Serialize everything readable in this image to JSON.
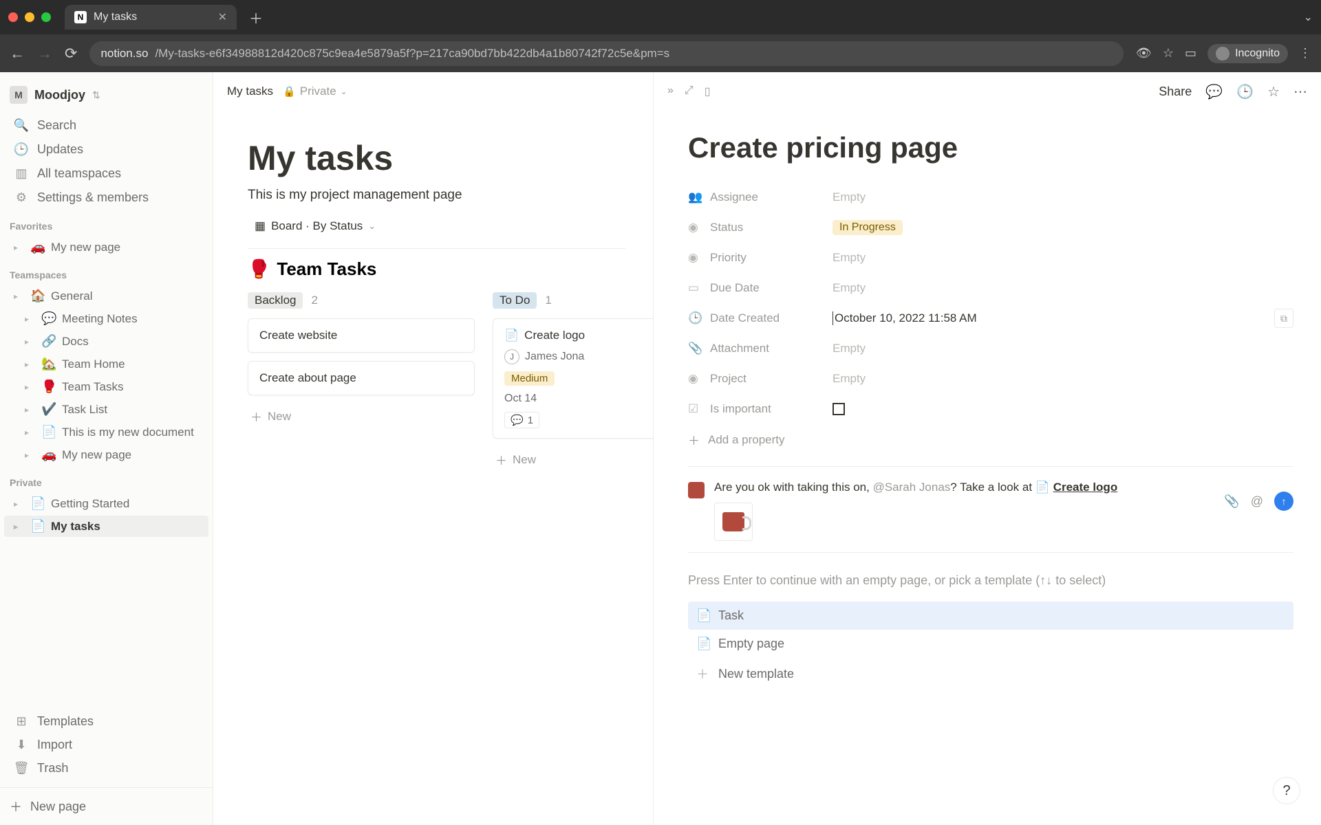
{
  "browser": {
    "tab_title": "My tasks",
    "url_domain": "notion.so",
    "url_path": "/My-tasks-e6f34988812d420c875c9ea4e5879a5f?p=217ca90bd7bb422db4a1b80742f72c5e&pm=s",
    "incognito_label": "Incognito"
  },
  "workspace": {
    "initial": "M",
    "name": "Moodjoy"
  },
  "sidebar": {
    "main": [
      {
        "icon": "🔍",
        "label": "Search"
      },
      {
        "icon": "🕒",
        "label": "Updates"
      },
      {
        "icon": "▥",
        "label": "All teamspaces"
      },
      {
        "icon": "⚙",
        "label": "Settings & members"
      }
    ],
    "sections": {
      "favorites_label": "Favorites",
      "favorites": [
        {
          "emoji": "🚗",
          "label": "My new page"
        }
      ],
      "teamspaces_label": "Teamspaces",
      "teamspaces": [
        {
          "emoji": "🏠",
          "label": "General",
          "indent": 0
        },
        {
          "emoji": "💬",
          "label": "Meeting Notes",
          "indent": 1
        },
        {
          "emoji": "🔗",
          "label": "Docs",
          "indent": 1
        },
        {
          "emoji": "🏡",
          "label": "Team Home",
          "indent": 1
        },
        {
          "emoji": "🥊",
          "label": "Team Tasks",
          "indent": 1
        },
        {
          "emoji": "✔️",
          "label": "Task List",
          "indent": 1
        },
        {
          "emoji": "📄",
          "label": "This is my new document",
          "indent": 1
        },
        {
          "emoji": "🚗",
          "label": "My new page",
          "indent": 1
        }
      ],
      "private_label": "Private",
      "private": [
        {
          "emoji": "📄",
          "label": "Getting Started"
        },
        {
          "emoji": "📄",
          "label": "My tasks",
          "active": true
        }
      ]
    },
    "bottom": [
      {
        "icon": "⊞",
        "label": "Templates"
      },
      {
        "icon": "⬇",
        "label": "Import"
      },
      {
        "icon": "🗑",
        "label": "Trash"
      }
    ],
    "new_page": "New page"
  },
  "breadcrumb": {
    "page": "My tasks",
    "visibility": "Private"
  },
  "page": {
    "title": "My tasks",
    "desc": "This is my project management page",
    "view_label": "Board · By Status",
    "db_emoji": "🥊",
    "db_title": "Team Tasks",
    "columns": [
      {
        "name": "Backlog",
        "count": "2",
        "pill_class": "pill-backlog",
        "cards": [
          {
            "title": "Create website"
          },
          {
            "title": "Create about page"
          }
        ]
      },
      {
        "name": "To Do",
        "count": "1",
        "pill_class": "pill-todo",
        "cards": [
          {
            "title": "Create logo",
            "has_icon": true,
            "assignee_initial": "J",
            "assignee": "James Jona",
            "priority": "Medium",
            "date": "Oct 14",
            "comments": "1"
          }
        ]
      }
    ],
    "new_label": "New"
  },
  "detail": {
    "share": "Share",
    "title": "Create pricing page",
    "properties": [
      {
        "icon": "👥",
        "label": "Assignee",
        "value": "",
        "empty": "Empty"
      },
      {
        "icon": "◉",
        "label": "Status",
        "value": "In Progress",
        "type": "status"
      },
      {
        "icon": "◉",
        "label": "Priority",
        "value": "",
        "empty": "Empty"
      },
      {
        "icon": "▭",
        "label": "Due Date",
        "value": "",
        "empty": "Empty"
      },
      {
        "icon": "🕒",
        "label": "Date Created",
        "value": "October 10, 2022 11:58 AM",
        "editing": true
      },
      {
        "icon": "📎",
        "label": "Attachment",
        "value": "",
        "empty": "Empty"
      },
      {
        "icon": "◉",
        "label": "Project",
        "value": "",
        "empty": "Empty"
      },
      {
        "icon": "☑",
        "label": "Is important",
        "type": "checkbox"
      }
    ],
    "add_property": "Add a property",
    "comment": {
      "text_before": "Are you ok with taking this on, ",
      "mention": "@Sarah Jonas",
      "text_mid": "? Take a look at ",
      "link_icon": "📄",
      "link": "Create logo"
    },
    "template_hint": "Press Enter to continue with an empty page, or pick a template (↑↓ to select)",
    "templates": [
      {
        "icon": "📄",
        "label": "Task",
        "selected": true
      },
      {
        "icon": "📄",
        "label": "Empty page"
      },
      {
        "icon": "＋",
        "label": "New template"
      }
    ]
  }
}
